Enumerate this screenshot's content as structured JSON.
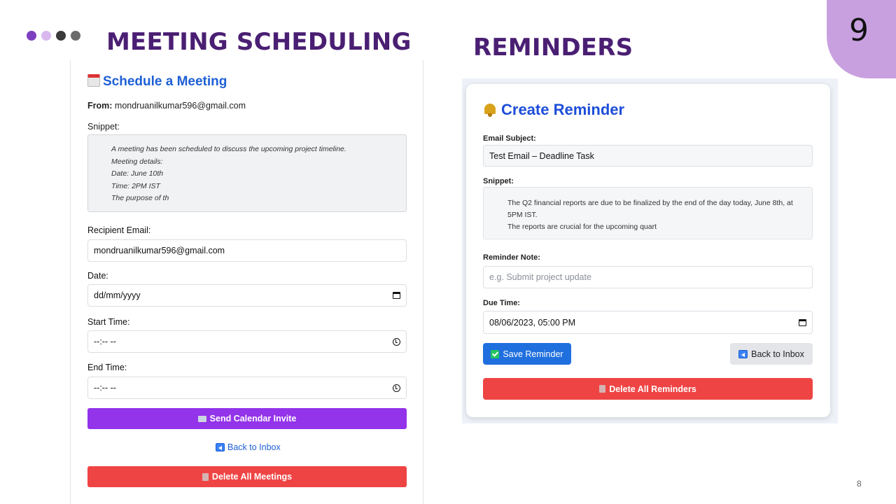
{
  "slide": {
    "number": "9",
    "page_number": "8",
    "left_title": "MEETING SCHEDULING",
    "right_title": "REMINDERS",
    "dot_colors": [
      "#7b3fbf",
      "#d9b8ef",
      "#3a3a3a",
      "#6b6b6b"
    ]
  },
  "meeting": {
    "title": "Schedule a Meeting",
    "from_label": "From:",
    "from_value": "mondruanilkumar596@gmail.com",
    "snippet_label": "Snippet:",
    "snippet_lines": [
      "A meeting has been scheduled to discuss the upcoming project timeline.",
      "Meeting details:",
      "Date: June 10th",
      "Time: 2PM IST",
      "The purpose of th"
    ],
    "recipient_label": "Recipient Email:",
    "recipient_value": "mondruanilkumar596@gmail.com",
    "date_label": "Date:",
    "date_value": "dd/mm/yyyy",
    "start_label": "Start Time:",
    "start_value": "--:-- --",
    "end_label": "End Time:",
    "end_value": "--:-- --",
    "send_button": "Send Calendar Invite",
    "back_link": "Back to Inbox",
    "delete_button": "Delete All Meetings"
  },
  "reminder": {
    "title": "Create Reminder",
    "subject_label": "Email Subject:",
    "subject_value": "Test Email – Deadline Task",
    "snippet_label": "Snippet:",
    "snippet_lines": [
      "The Q2 financial reports are due to be finalized by the end of the day today, June 8th, at 5PM IST.",
      "The reports are crucial for the upcoming quart"
    ],
    "note_label": "Reminder Note:",
    "note_placeholder": "e.g. Submit project update",
    "due_label": "Due Time:",
    "due_value": "08/06/2023, 05:00 PM",
    "save_button": "Save Reminder",
    "back_button": "Back to Inbox",
    "delete_button": "Delete All Reminders"
  }
}
